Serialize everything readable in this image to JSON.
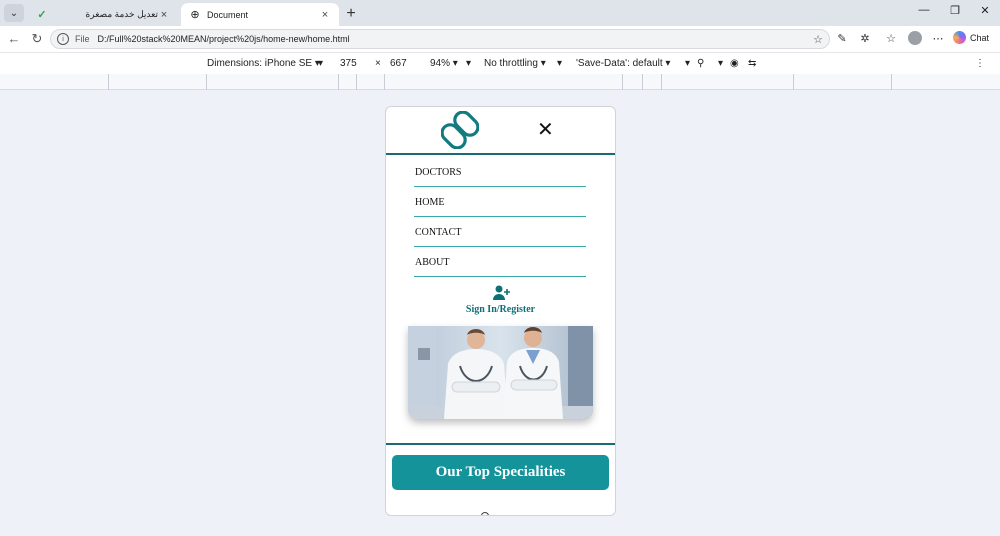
{
  "browser": {
    "tabs": [
      {
        "title": "تعديل خدمة مصغرة",
        "active": false
      },
      {
        "title": "Document",
        "active": true
      }
    ],
    "address": {
      "scheme": "File",
      "url": "D:/Full%20stack%20MEAN/project%20js/home-new/home.html"
    },
    "chat_label": "Chat"
  },
  "devtools": {
    "dimensions": "Dimensions: iPhone SE ▾",
    "width": "375",
    "times": "×",
    "height": "667",
    "zoom": "94% ▾",
    "throttling": "No throttling ▾",
    "save_data": "'Save-Data': default ▾"
  },
  "site": {
    "menu": [
      "DOCTORS",
      "HOME",
      "CONTACT",
      "ABOUT"
    ],
    "signin_label": "Sign In/Register",
    "specialities_button": "Our Top Specialities"
  },
  "colors": {
    "accent": "#14939a",
    "dark_teal": "#1b6b74"
  }
}
